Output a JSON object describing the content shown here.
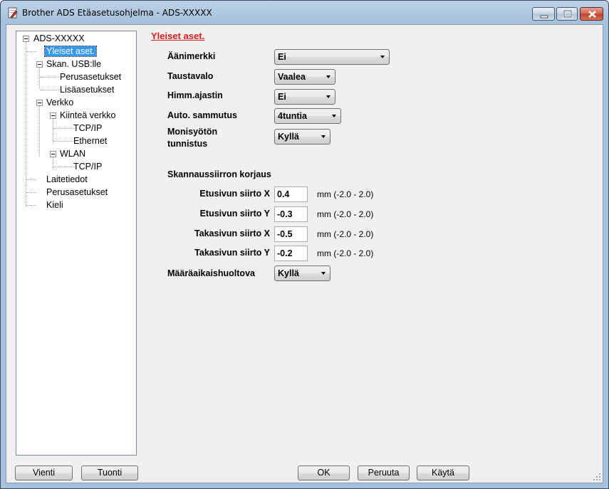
{
  "window": {
    "title": "Brother ADS Etäasetusohjelma - ADS-XXXXX",
    "app_icon": "printer-settings-icon"
  },
  "tree": {
    "root": "ADS-XXXXX",
    "items": [
      "Yleiset aset.",
      "Skan. USB:lle",
      "Perusasetukset",
      "Lisäasetukset",
      "Verkko",
      "Kiinteä verkko",
      "TCP/IP",
      "Ethernet",
      "WLAN",
      "TCP/IP",
      "Laitetiedot",
      "Perusasetukset",
      "Kieli"
    ],
    "selected": "Yleiset aset."
  },
  "panel": {
    "heading": "Yleiset aset.",
    "beep_label": "Äänimerkki",
    "beep_value": "Ei",
    "backlight_label": "Taustavalo",
    "backlight_value": "Vaalea",
    "dim_timer_label": "Himm.ajastin",
    "dim_timer_value": "Ei",
    "auto_off_label": "Auto. sammutus",
    "auto_off_value": "4tuntia",
    "multifeed_label_1": "Monisyötön",
    "multifeed_label_2": "tunnistus",
    "multifeed_value": "Kyllä",
    "scan_correction_title": "Skannaussiirron korjaus",
    "front_x_label": "Etusivun siirto X",
    "front_x_value": "0.4",
    "front_y_label": "Etusivun siirto Y",
    "front_y_value": "-0.3",
    "back_x_label": "Takasivun siirto X",
    "back_x_value": "-0.5",
    "back_y_label": "Takasivun siirto Y",
    "back_y_value": "-0.2",
    "range_hint": "mm (-2.0 - 2.0)",
    "maintenance_label": "Määräaikaishuoltova",
    "maintenance_value": "Kyllä"
  },
  "buttons": {
    "export": "Vienti",
    "import": "Tuonti",
    "ok": "OK",
    "cancel": "Peruuta",
    "apply": "Käytä"
  }
}
